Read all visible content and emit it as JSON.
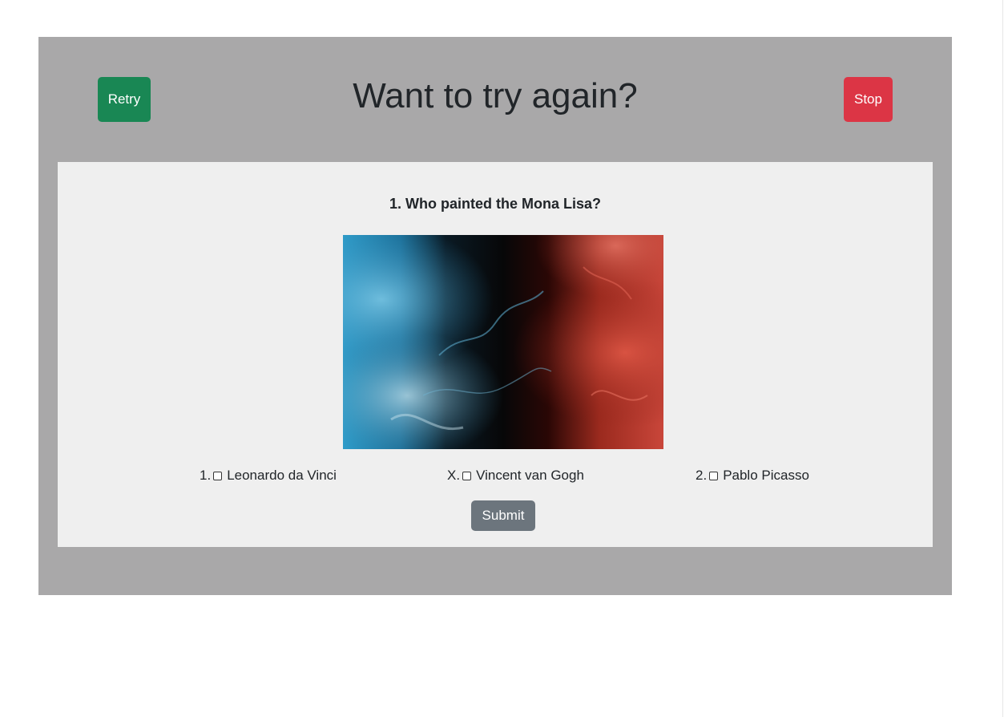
{
  "header": {
    "title": "Want to try again?",
    "retry_label": "Retry",
    "stop_label": "Stop"
  },
  "quiz": {
    "question": "1. Who painted the Mona Lisa?",
    "options": [
      {
        "marker": "1.",
        "label": "Leonardo da Vinci",
        "checked": false
      },
      {
        "marker": "X.",
        "label": "Vincent van Gogh",
        "checked": false
      },
      {
        "marker": "2.",
        "label": "Pablo Picasso",
        "checked": false
      }
    ],
    "submit_label": "Submit"
  },
  "colors": {
    "outer_background": "#a9a8a9",
    "card_background": "#efefef",
    "retry": "#198754",
    "stop": "#dc3545",
    "submit": "#6c757d"
  },
  "icons": {
    "question_image": "abstract-fluid-painting-blue-red"
  }
}
